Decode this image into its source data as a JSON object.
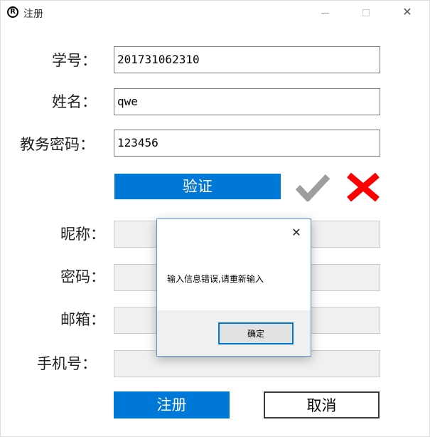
{
  "window": {
    "title": "注册",
    "app_icon": "registered-mark-icon",
    "app_icon_glyph": "R"
  },
  "titlebar": {
    "minimize_icon": "minimize-icon",
    "maximize_icon": "maximize-icon",
    "close_icon": "close-icon"
  },
  "form": {
    "student_id": {
      "label": "学号：",
      "value": "201731062310"
    },
    "name": {
      "label": "姓名：",
      "value": "qwe"
    },
    "password_academic": {
      "label": "教务密码：",
      "value": "123456"
    },
    "verify_button": "验证",
    "check_icon": "checkmark-icon",
    "cross_icon": "red-x-icon",
    "nickname": {
      "label": "昵称：",
      "value": ""
    },
    "password": {
      "label": "密码：",
      "value": ""
    },
    "email": {
      "label": "邮箱：",
      "value": ""
    },
    "phone": {
      "label": "手机号：",
      "value": ""
    },
    "register_button": "注册",
    "cancel_button": "取消"
  },
  "dialog": {
    "message": "输入信息错误,请重新输入",
    "ok_button": "确定",
    "close_icon": "close-icon"
  },
  "colors": {
    "accent": "#0078d7",
    "error": "#ff0000",
    "check_gray": "#9e9e9e",
    "disabled_bg": "#f0f0f0"
  }
}
